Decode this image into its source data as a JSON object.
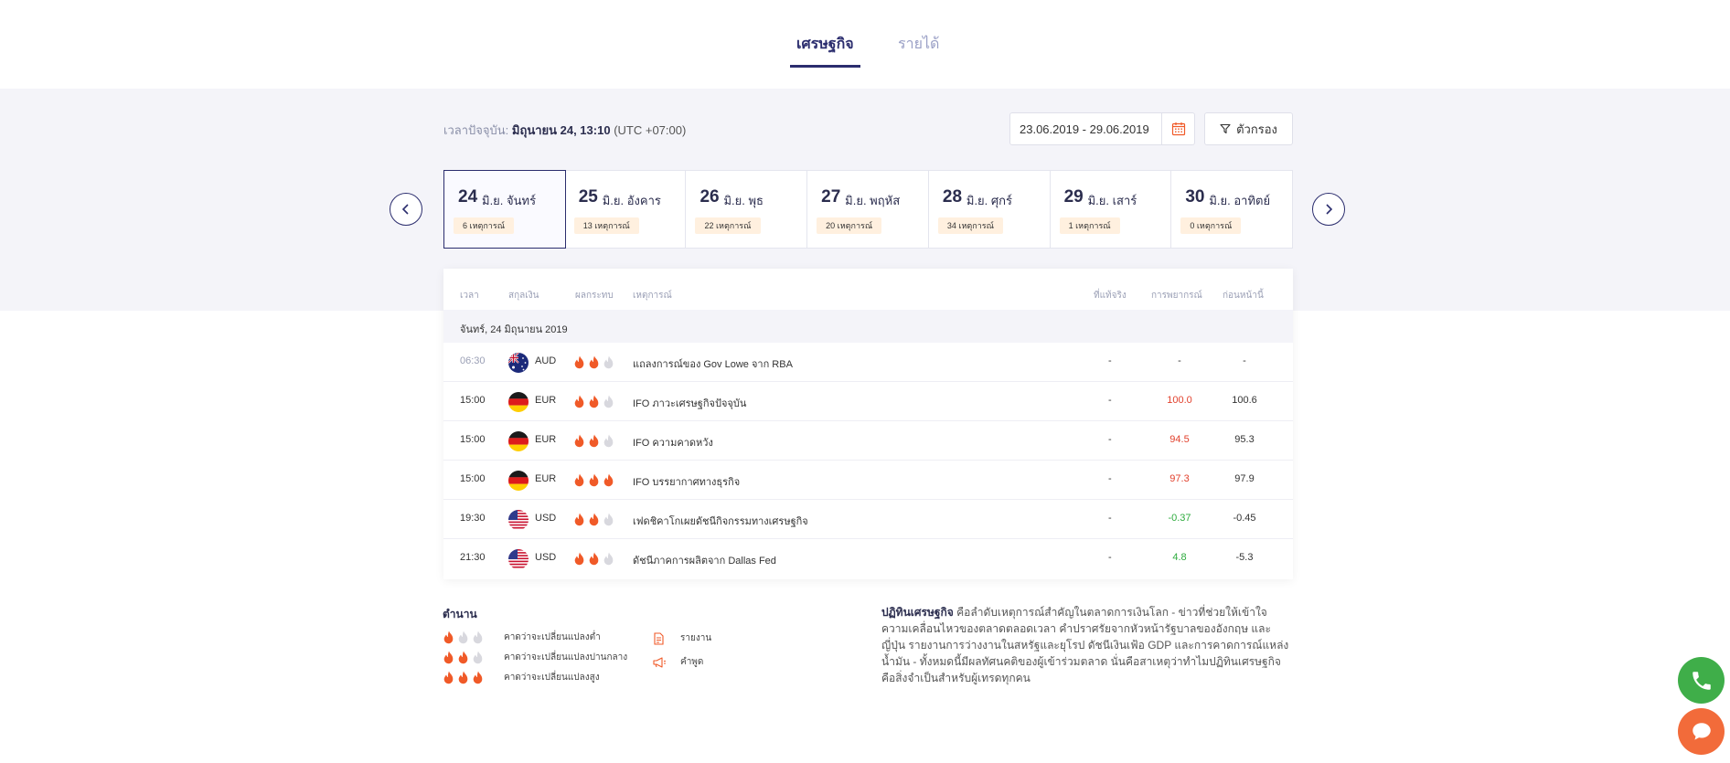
{
  "tabs": [
    {
      "label": "เศรษฐกิจ",
      "active": true
    },
    {
      "label": "รายได้",
      "active": false
    }
  ],
  "current_time": {
    "label": "เวลาปัจจุบัน:",
    "value": "มิถุนายน 24, 13:10",
    "timezone": "(UTC +07:00)"
  },
  "date_range": "23.06.2019 - 29.06.2019",
  "filter_label": "ตัวกรอง",
  "days": [
    {
      "num": "24",
      "label": "มิ.ย. จันทร์",
      "events": "6 เหตุการณ์",
      "active": true
    },
    {
      "num": "25",
      "label": "มิ.ย. อังคาร",
      "events": "13 เหตุการณ์",
      "active": false
    },
    {
      "num": "26",
      "label": "มิ.ย. พุธ",
      "events": "22 เหตุการณ์",
      "active": false
    },
    {
      "num": "27",
      "label": "มิ.ย. พฤหัส",
      "events": "20 เหตุการณ์",
      "active": false
    },
    {
      "num": "28",
      "label": "มิ.ย. ศุกร์",
      "events": "34 เหตุการณ์",
      "active": false
    },
    {
      "num": "29",
      "label": "มิ.ย. เสาร์",
      "events": "1 เหตุการณ์",
      "active": false
    },
    {
      "num": "30",
      "label": "มิ.ย. อาทิตย์",
      "events": "0 เหตุการณ์",
      "active": false
    }
  ],
  "table": {
    "headers": {
      "time": "เวลา",
      "currency": "สกุลเงิน",
      "impact": "ผลกระทบ",
      "event": "เหตุการณ์",
      "actual": "ที่แท้จริง",
      "forecast": "การพยากรณ์",
      "previous": "ก่อนหน้านี้"
    },
    "date_header": "จันทร์, 24 มิถุนายน 2019",
    "rows": [
      {
        "time": "06:30",
        "time_muted": true,
        "flag": "au",
        "currency": "AUD",
        "impact": 2,
        "event": "แถลงการณ์ของ Gov Lowe จาก RBA",
        "actual": "-",
        "forecast": "-",
        "forecast_color": "",
        "previous": "-"
      },
      {
        "time": "15:00",
        "time_muted": false,
        "flag": "de",
        "currency": "EUR",
        "impact": 2,
        "event": "IFO ภาวะเศรษฐกิจปัจจุบัน",
        "actual": "-",
        "forecast": "100.0",
        "forecast_color": "red",
        "previous": "100.6"
      },
      {
        "time": "15:00",
        "time_muted": false,
        "flag": "de",
        "currency": "EUR",
        "impact": 2,
        "event": "IFO ความคาดหวัง",
        "actual": "-",
        "forecast": "94.5",
        "forecast_color": "red",
        "previous": "95.3"
      },
      {
        "time": "15:00",
        "time_muted": false,
        "flag": "de",
        "currency": "EUR",
        "impact": 3,
        "event": "IFO บรรยากาศทางธุรกิจ",
        "actual": "-",
        "forecast": "97.3",
        "forecast_color": "red",
        "previous": "97.9"
      },
      {
        "time": "19:30",
        "time_muted": false,
        "flag": "us",
        "currency": "USD",
        "impact": 2,
        "event": "เฟดชิคาโกเผยดัชนีกิจกรรมทางเศรษฐกิจ",
        "actual": "-",
        "forecast": "-0.37",
        "forecast_color": "green",
        "previous": "-0.45"
      },
      {
        "time": "21:30",
        "time_muted": false,
        "flag": "us",
        "currency": "USD",
        "impact": 2,
        "event": "ดัชนีภาคการผลิตจาก Dallas Fed",
        "actual": "-",
        "forecast": "4.8",
        "forecast_color": "green",
        "previous": "-5.3"
      }
    ]
  },
  "legend": {
    "title": "ตำนาน",
    "impact_items": [
      {
        "level": 1,
        "label": "คาดว่าจะเปลี่ยนแปลงต่ำ"
      },
      {
        "level": 2,
        "label": "คาดว่าจะเปลี่ยนแปลงปานกลาง"
      },
      {
        "level": 3,
        "label": "คาดว่าจะเปลี่ยนแปลงสูง"
      }
    ],
    "type_items": [
      {
        "icon": "report-icon",
        "label": "รายงาน"
      },
      {
        "icon": "speech-icon",
        "label": "คำพูด"
      }
    ]
  },
  "description": {
    "title": "ปฏิทินเศรษฐกิจ",
    "body": " คือลำดับเหตุการณ์สำคัญในตลาดการเงินโลก - ข่าวที่ช่วยให้เข้าใจความเคลื่อนไหวของตลาดตลอดเวลา คำปราศรัยจากหัวหน้ารัฐบาลของอังกฤษ และญี่ปุ่น รายงานการว่างงานในสหรัฐและยุโรป ดัชนีเงินเฟ้อ GDP และการคาดการณ์แหล่งน้ำมัน - ทั้งหมดนี้มีผลทัศนคติของผู้เข้าร่วมตลาด นั่นคือสาเหตุว่าทำไมปฏิทินเศรษฐกิจคือสิ่งจำเป็นสำหรับผู้เทรดทุกคน"
  },
  "colors": {
    "primary": "#2b2d6e",
    "flame": "#f05a28",
    "flame_off": "#d8d8de",
    "phone_fab": "#3fae49",
    "chat_fab": "#f26b3a"
  }
}
